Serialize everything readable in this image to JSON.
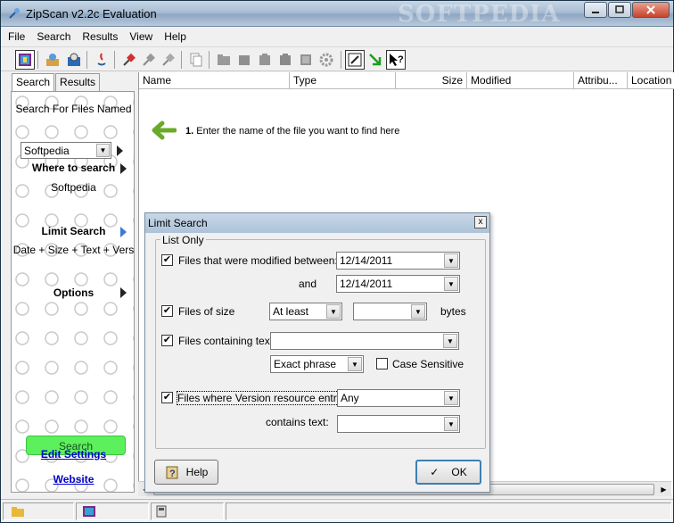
{
  "window": {
    "title": "ZipScan v2.2c Evaluation",
    "watermark": "SOFTPEDIA"
  },
  "menu": [
    "File",
    "Search",
    "Results",
    "View",
    "Help"
  ],
  "toolbar_icons": [
    "zip-archive-icon",
    "find-icon",
    "find-in-archive-icon",
    "java-icon",
    "pin-icon",
    "pin-gray-icon",
    "pin-gray2-icon",
    "copy-icon",
    "folder-gray-icon",
    "box-gray-icon",
    "box2-gray-icon",
    "box3-gray-icon",
    "box4-gray-icon",
    "gear-gray-icon",
    "properties-icon",
    "arrow-down-icon",
    "help-cursor-icon"
  ],
  "left_panel": {
    "tabs": [
      "Search",
      "Results"
    ],
    "search_for_label": "Search For Files Named",
    "search_for_value": "Softpedia",
    "where_label": "Where to search",
    "where_value": "Softpedia",
    "limit_label": "Limit Search",
    "limit_value": "Date + Size + Text + Vers",
    "options_label": "Options",
    "search_button": "Search",
    "edit_settings": "Edit Settings",
    "website": "Website"
  },
  "results": {
    "columns": [
      "Name",
      "Type",
      "Size",
      "Modified",
      "Attribu...",
      "Location"
    ],
    "hint_step": "1.",
    "hint_text": "Enter the name of the file you want to find here"
  },
  "dialog": {
    "title": "Limit Search",
    "close": "x",
    "group_label": "List Only",
    "modified_label": "Files that were modified between:",
    "modified_checked": true,
    "date_from": "12/14/2011",
    "and_label": "and",
    "date_to": "12/14/2011",
    "size_label": "Files of size",
    "size_checked": true,
    "size_mode": "At least",
    "size_value": "",
    "bytes_label": "bytes",
    "text_label": "Files containing text",
    "text_checked": true,
    "text_value": "",
    "match_mode": "Exact phrase",
    "case_label": "Case Sensitive",
    "case_checked": false,
    "version_label": "Files where Version resource entry:",
    "version_checked": true,
    "version_value": "Any",
    "contains_label": "contains text:",
    "contains_value": "",
    "help_button": "Help",
    "ok_button": "OK"
  },
  "colors": {
    "search_button": "#5cf05c",
    "hint_arrow": "#6aaa2a",
    "link": "#0000cc"
  }
}
